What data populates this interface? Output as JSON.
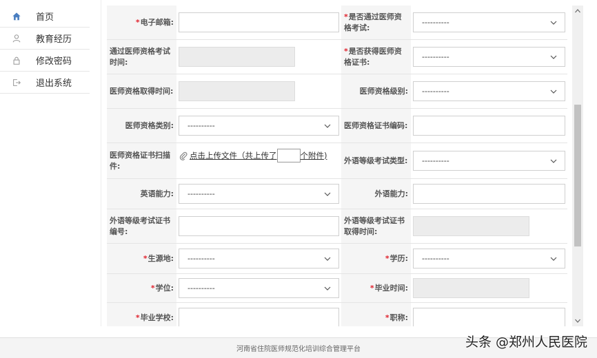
{
  "sidebar": {
    "items": [
      {
        "label": "首页",
        "icon": "home-icon"
      },
      {
        "label": "教育经历",
        "icon": "user-icon"
      },
      {
        "label": "修改密码",
        "icon": "lock-icon"
      },
      {
        "label": "退出系统",
        "icon": "logout-icon"
      }
    ]
  },
  "form": {
    "select_placeholder": "----------",
    "rows": [
      {
        "left_label": "电子邮箱:",
        "left_required": "*",
        "right_label": "是否通过医师资格考试:",
        "right_required": "*"
      },
      {
        "left_label": "通过医师资格考试时间:",
        "right_label": "是否获得医师资格证书:",
        "right_required": "*"
      },
      {
        "left_label": "医师资格取得时间:",
        "right_label": "医师资格级别:"
      },
      {
        "left_label": "医师资格类别:",
        "right_label": "医师资格证书编码:"
      },
      {
        "left_label": "医师资格证书扫描件:",
        "right_label": "外语等级考试类型:"
      },
      {
        "left_label": "英语能力:",
        "right_label": "外语能力:"
      },
      {
        "left_label": "外语等级考试证书编号:",
        "right_label": "外语等级考试证书取得时间:"
      },
      {
        "left_label": "生源地:",
        "left_required": "*",
        "right_label": "学历:",
        "right_required": "*"
      },
      {
        "left_label": "学位:",
        "left_required": "*",
        "right_label": "毕业时间:",
        "right_required": "*"
      },
      {
        "left_label": "毕业学校:",
        "left_required": "*",
        "right_label": "职称:",
        "right_required": "*"
      }
    ],
    "upload": {
      "link_text_before": "点击上传文件（共上传了",
      "count_value": "",
      "link_text_after": "个附件)"
    }
  },
  "footer": {
    "text": "河南省住院医师规范化培训综合管理平台"
  },
  "watermark": {
    "text": "头条 @郑州人民医院"
  },
  "colors": {
    "required": "#e0232e",
    "label_bg": "#f5f5f5",
    "readonly_bg": "#ececec",
    "home_icon": "#4a7fc1"
  }
}
